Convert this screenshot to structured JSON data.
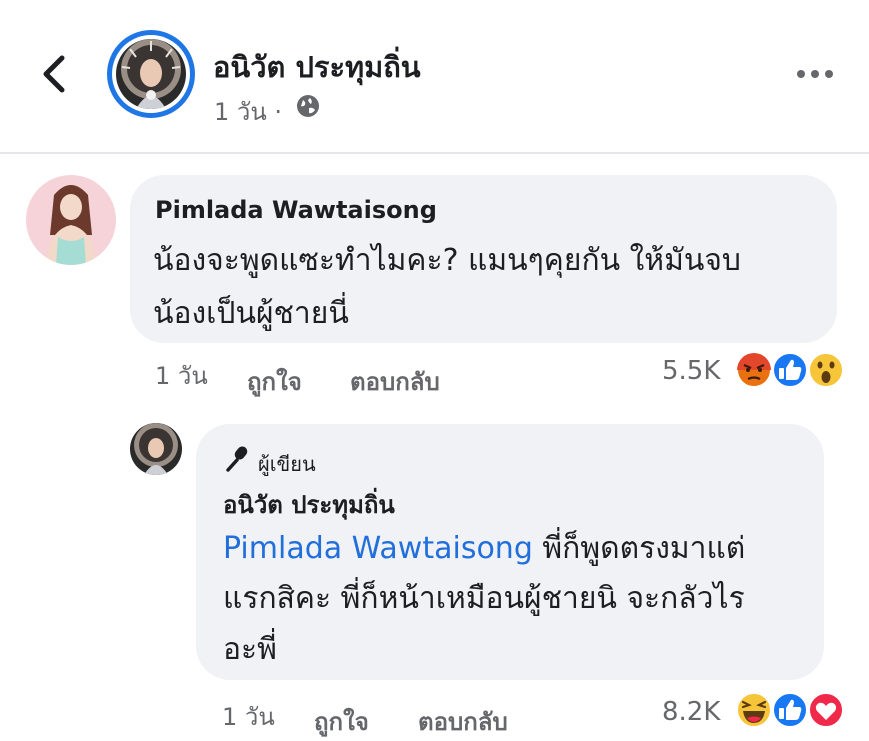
{
  "post": {
    "author_name": "อนิวัต ประทุมถิ่น",
    "time": "1 วัน ·",
    "privacy_icon": "globe-icon",
    "back_icon": "chevron-left-icon",
    "more_icon": "more-horizontal-icon"
  },
  "comment": {
    "author": "Pimlada Wawtaisong",
    "text_line1": "น้องจะพูดแซะทำไมคะ? แมนๆคุยกัน ให้มันจบ",
    "text_line2": "น้องเป็นผู้ชายนี่",
    "time": "1 วัน",
    "like_label": "ถูกใจ",
    "reply_label": "ตอบกลับ",
    "reaction_count": "5.5K",
    "reactions": [
      "angry-icon",
      "like-icon",
      "wow-icon"
    ]
  },
  "reply": {
    "badge_label": "ผู้เขียน",
    "badge_icon": "microphone-icon",
    "author": "อนิวัต ประทุมถิ่น",
    "mention": "Pimlada Wawtaisong",
    "text_line1_rest": " พี่ก็พูดตรงมาแต่",
    "text_line2": "แรกสิคะ พี่ก็หน้าเหมือนผู้ชายนิ จะกลัวไร",
    "text_line3": "อะพี่",
    "time": "1 วัน",
    "like_label": "ถูกใจ",
    "reply_label": "ตอบกลับ",
    "reaction_count": "8.2K",
    "reactions": [
      "haha-icon",
      "like-icon",
      "love-icon"
    ]
  },
  "colors": {
    "accent_blue": "#1877f2",
    "mention_blue": "#216fdb",
    "bubble_bg": "#f0f2f5",
    "secondary_text": "#65676b"
  }
}
